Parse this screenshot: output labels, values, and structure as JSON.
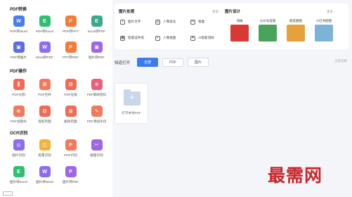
{
  "sections": {
    "pdf_convert": "PDF转换",
    "pdf_ops": "PDF操作",
    "ocr": "OCR识别"
  },
  "tools_row1": [
    {
      "label": "PDF转Word",
      "glyph": "W",
      "color": "#4a7bf0"
    },
    {
      "label": "PDF转Excel",
      "glyph": "E",
      "color": "#2fbf71"
    },
    {
      "label": "PDF转PPT",
      "glyph": "P",
      "color": "#f47a3b"
    },
    {
      "label": "Excel转PDF",
      "glyph": "E",
      "color": "#3aa98b"
    }
  ],
  "tools_row2": [
    {
      "label": "PDF转图片",
      "glyph": "▣",
      "color": "#5b6de8"
    },
    {
      "label": "Word转PDF",
      "glyph": "W",
      "color": "#8d6cf0"
    },
    {
      "label": "PPT转PDF",
      "glyph": "P",
      "color": "#f47a3b"
    },
    {
      "label": "图片转PDF",
      "glyph": "▣",
      "color": "#a066e6"
    }
  ],
  "tools_ops": [
    {
      "label": "PDF分割",
      "glyph": "⫼",
      "color": "#f16a55"
    },
    {
      "label": "PDF合并",
      "glyph": "⊞",
      "color": "#f2795c"
    },
    {
      "label": "PDF压缩",
      "glyph": "⊡",
      "color": "#f16a55"
    },
    {
      "label": "PDF解除密码",
      "glyph": "⊙",
      "color": "#e86079"
    },
    {
      "label": "PDF加密码",
      "glyph": "⊕",
      "color": "#f2795c"
    },
    {
      "label": "提取页面",
      "glyph": "⊟",
      "color": "#f16a55"
    },
    {
      "label": "删除页面",
      "glyph": "⊠",
      "color": "#f16a55"
    },
    {
      "label": "PDF添加水印",
      "glyph": "✎",
      "color": "#f2795c"
    }
  ],
  "tools_ocr": [
    {
      "label": "图片识别",
      "glyph": "◎",
      "color": "#8d6cf0"
    },
    {
      "label": "批量识别",
      "glyph": "◫",
      "color": "#f1b33b"
    },
    {
      "label": "PDF识别",
      "glyph": "P",
      "color": "#f2795c"
    },
    {
      "label": "截图识别",
      "glyph": "✂",
      "color": "#a066e6"
    },
    {
      "label": "图片转Excel",
      "glyph": "E",
      "color": "#2fbf71"
    },
    {
      "label": "图片转Word",
      "glyph": "W",
      "color": "#8d6cf0"
    },
    {
      "label": "图片转PDF",
      "glyph": "P",
      "color": "#a066e6"
    }
  ],
  "image_tools": {
    "title": "图片处理",
    "more": "更多 ›",
    "items": [
      {
        "label": "图片文字",
        "glyph": "T"
      },
      {
        "label": "人像美化",
        "glyph": "◎"
      },
      {
        "label": "抠图",
        "glyph": "✂"
      },
      {
        "label": "智能证件照",
        "glyph": "▣"
      },
      {
        "label": "人像抠图",
        "glyph": "◐"
      },
      {
        "label": "AI智能消除",
        "glyph": "✦"
      }
    ]
  },
  "design": {
    "title": "图片设计",
    "more": "更多 ›",
    "items": [
      {
        "label": "海报",
        "color": "#d63a32"
      },
      {
        "label": "公众号首图",
        "color": "#4aa35a"
      },
      {
        "label": "朋友圈图",
        "color": "#e6a13a"
      },
      {
        "label": "小红书配图",
        "color": "#7bb3d9"
      }
    ]
  },
  "files": {
    "title": "知道打开",
    "tabs": [
      "全部",
      "PDF",
      "图片"
    ],
    "select_all": "全部选择",
    "card_label": "打开本地PDF"
  },
  "watermark": "最需网"
}
